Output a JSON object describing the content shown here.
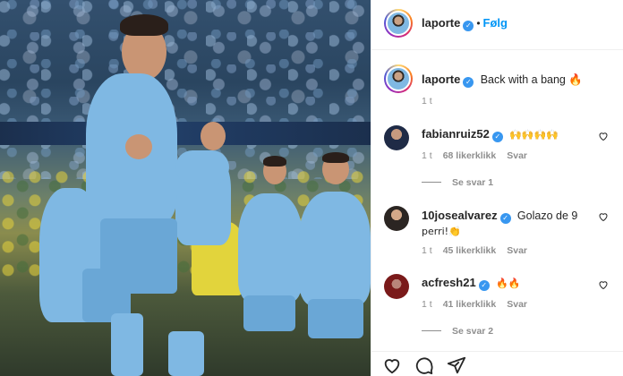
{
  "post": {
    "author": "laporte",
    "follow_label": "Følg",
    "dot": "•",
    "verified_glyph": "✓"
  },
  "caption": {
    "username": "laporte",
    "text": "Back with a bang 🔥",
    "age": "1 t"
  },
  "comments": [
    {
      "username": "fabianruiz52",
      "text": "🙌🙌🙌🙌",
      "age": "1 t",
      "likes": "68 likerklikk",
      "reply_label": "Svar",
      "view_replies": "Se svar 1"
    },
    {
      "username": "10josealvarez",
      "text_line1": "Golazo de 9",
      "text_line2": "perri!👏",
      "age": "1 t",
      "likes": "45 likerklikk",
      "reply_label": "Svar"
    },
    {
      "username": "acfresh21",
      "text": "🔥🔥",
      "age": "1 t",
      "likes": "41 likerklikk",
      "reply_label": "Svar",
      "view_replies": "Se svar 2"
    }
  ],
  "colors": {
    "link": "#0095f6",
    "verified": "#3897f0",
    "muted": "#8e8e8e",
    "text": "#262626"
  },
  "icons": [
    "heart-icon",
    "comment-icon",
    "share-icon",
    "verified-icon"
  ]
}
